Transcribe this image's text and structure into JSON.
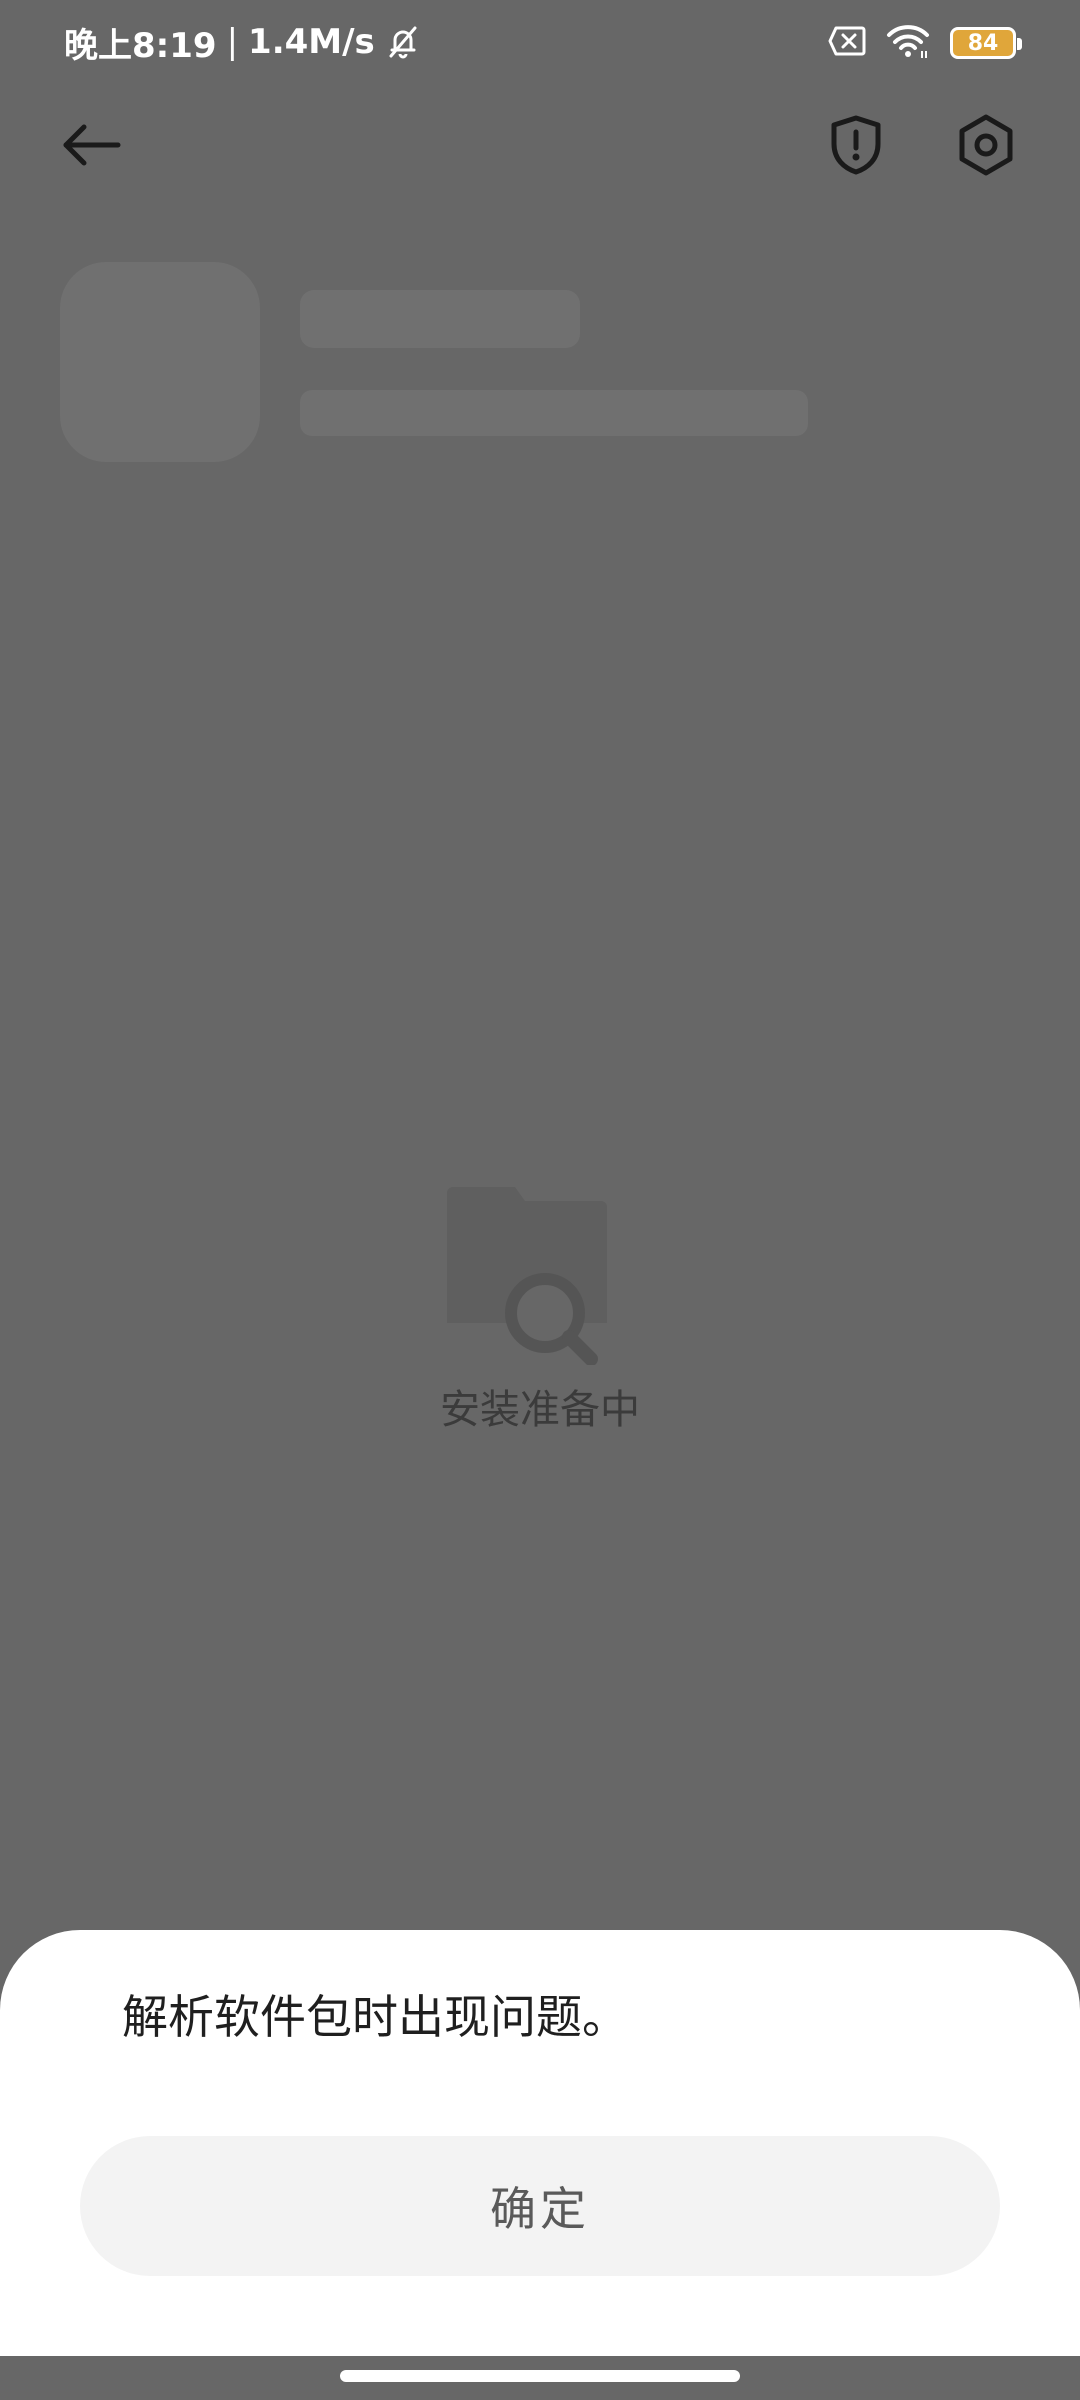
{
  "status_bar": {
    "time": "晚上8:19",
    "separator": "|",
    "network_speed": "1.4M/s",
    "battery_level": "84",
    "icons": [
      "bell-off-icon",
      "sim-disabled-icon",
      "wifi-icon",
      "battery-icon"
    ],
    "battery_color": "#e0a63a"
  },
  "app_bar": {
    "icons": [
      "back-arrow-icon",
      "shield-alert-icon",
      "settings-hex-icon"
    ]
  },
  "loading": {
    "text": "安装准备中",
    "icon": "folder-search-icon"
  },
  "dialog": {
    "message": "解析软件包时出现问题。",
    "confirm_label": "确定"
  },
  "colors": {
    "scrim": "#676767",
    "sheet": "#ffffff",
    "button_bg": "#f3f3f3"
  }
}
